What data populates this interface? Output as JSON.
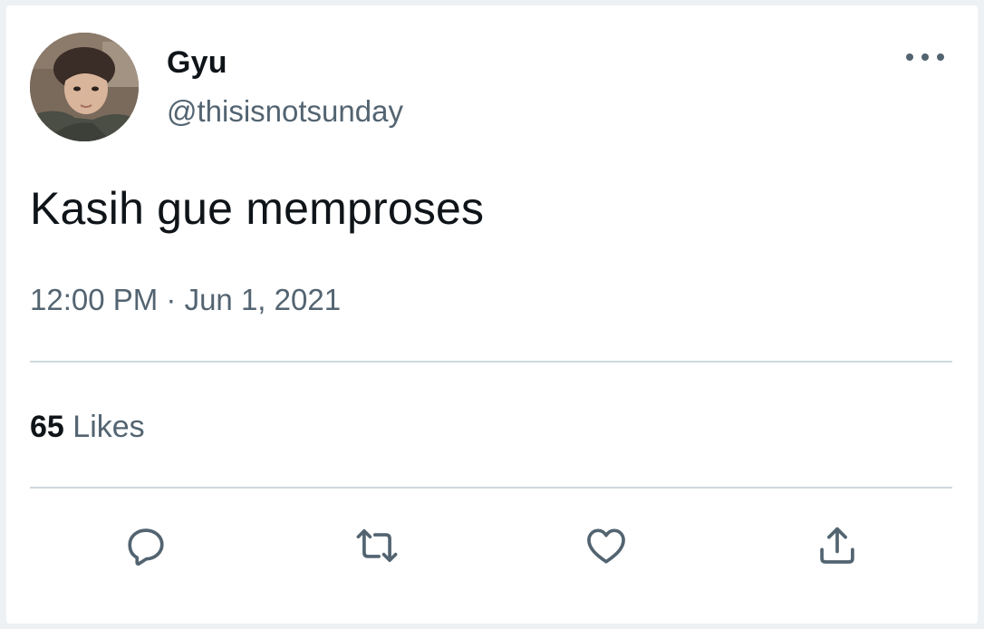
{
  "tweet": {
    "author_name": "Gyu",
    "author_handle": "@thisisnotsunday",
    "text": "Kasih gue memproses",
    "timestamp": "12:00 PM · Jun 1, 2021",
    "likes_count": "65",
    "likes_label": "Likes"
  },
  "icons": {
    "more": "more-horizontal-icon",
    "reply": "reply-icon",
    "retweet": "retweet-icon",
    "like": "heart-icon",
    "share": "share-icon"
  },
  "colors": {
    "primary_text": "#0f1419",
    "secondary_text": "#536471",
    "divider": "#cfd9de",
    "background": "#ffffff"
  }
}
